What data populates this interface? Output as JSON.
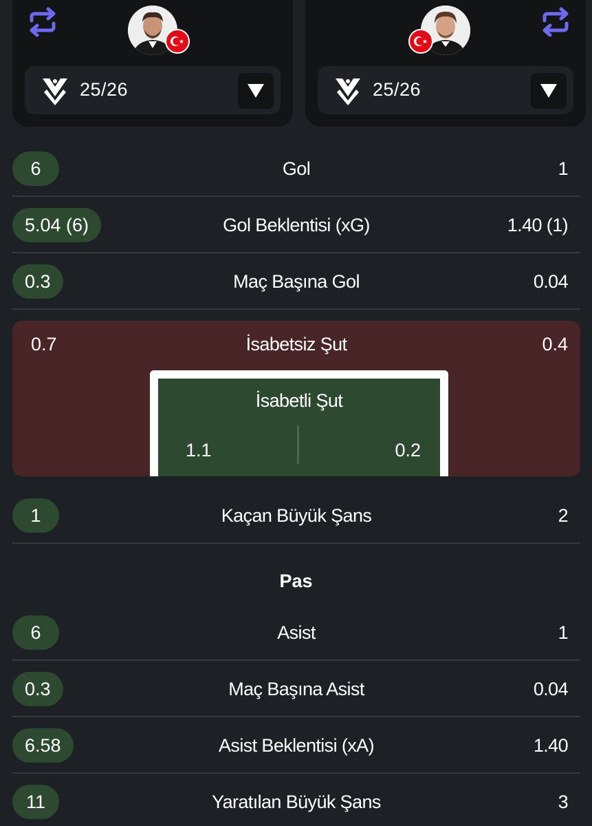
{
  "players": {
    "left": {
      "season": "25/26",
      "flag": "turkey-flag"
    },
    "right": {
      "season": "25/26",
      "flag": "turkey-flag"
    }
  },
  "colors": {
    "positive_pill": "#2d4a30",
    "shot_box": "#4a2527",
    "swap_icon": "#6d6af0",
    "background": "#1d2024"
  },
  "rows_top": [
    {
      "left": "6",
      "label": "Gol",
      "right": "1"
    },
    {
      "left": "5.04 (6)",
      "label": "Gol Beklentisi (xG)",
      "right": "1.40 (1)"
    },
    {
      "left": "0.3",
      "label": "Maç Başına Gol",
      "right": "0.04"
    }
  ],
  "shots": {
    "off_label": "İsabetsiz Şut",
    "off_left": "0.7",
    "off_right": "0.4",
    "on_label": "İsabetli Şut",
    "on_left": "1.1",
    "on_right": "0.2"
  },
  "big_chance_missed": {
    "left": "1",
    "label": "Kaçan Büyük Şans",
    "right": "2"
  },
  "pass_section": {
    "title": "Pas",
    "rows": [
      {
        "left": "6",
        "label": "Asist",
        "right": "1"
      },
      {
        "left": "0.3",
        "label": "Maç Başına Asist",
        "right": "0.04"
      },
      {
        "left": "6.58",
        "label": "Asist Beklentisi (xA)",
        "right": "1.40"
      },
      {
        "left": "11",
        "label": "Yaratılan Büyük Şans",
        "right": "3"
      }
    ]
  }
}
